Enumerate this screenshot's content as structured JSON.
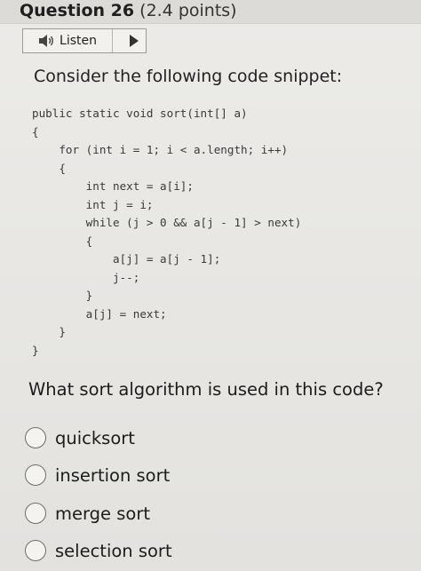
{
  "question": {
    "number_label": "Question 26",
    "points_label": "(2.4 points)"
  },
  "listen": {
    "label": "Listen",
    "speaker_icon": "speaker-icon",
    "play_icon": "play-icon"
  },
  "prompt": "Consider the following code snippet:",
  "code_lines": [
    "public static void sort(int[] a)",
    "{",
    "    for (int i = 1; i < a.length; i++)",
    "    {",
    "        int next = a[i];",
    "        int j = i;",
    "        while (j > 0 && a[j - 1] > next)",
    "        {",
    "            a[j] = a[j - 1];",
    "            j--;",
    "        }",
    "        a[j] = next;",
    "    }",
    "}"
  ],
  "question_text": "What sort algorithm is used in this code?",
  "options": [
    {
      "label": "quicksort"
    },
    {
      "label": "insertion sort"
    },
    {
      "label": "merge sort"
    },
    {
      "label": "selection sort"
    }
  ]
}
